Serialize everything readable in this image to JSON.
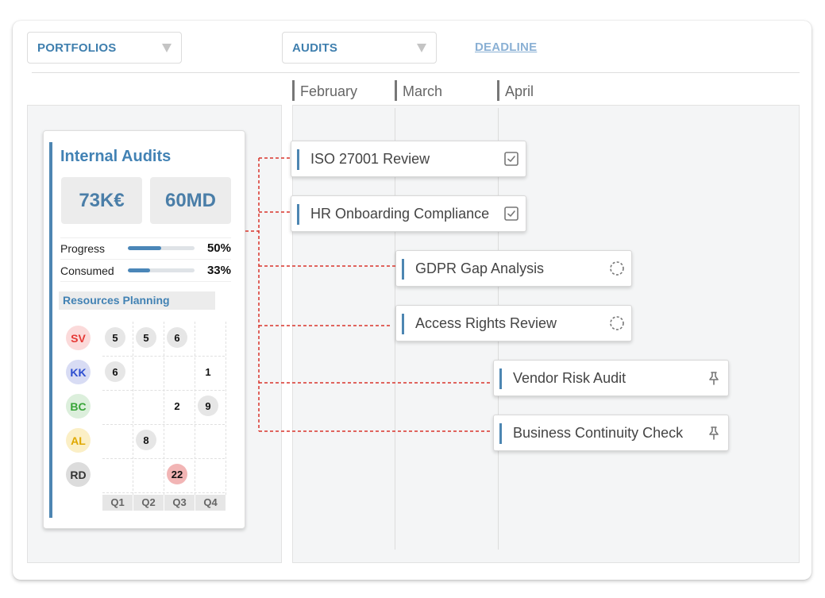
{
  "filters": {
    "portfolios": {
      "label": "PORTFOLIOS",
      "icon": "caret-down-icon"
    },
    "audits": {
      "label": "AUDITS",
      "icon": "caret-down-icon"
    },
    "deadline": {
      "label": "DEADLINE"
    }
  },
  "timeline": {
    "months": [
      "February",
      "March",
      "April"
    ]
  },
  "portfolio_card": {
    "title": "Internal Audits",
    "kpis": {
      "budget": "73K€",
      "effort": "60MD"
    },
    "progress": {
      "label": "Progress",
      "value": "50%",
      "fraction": 0.5
    },
    "consumed": {
      "label": "Consumed",
      "value": "33%",
      "fraction": 0.33
    },
    "resources_title": "Resources Planning",
    "resources": [
      {
        "initials": "SV",
        "color": "#e53935",
        "bg": "#fbdada",
        "q1": "5",
        "q2": "5",
        "q3": "6",
        "q4": ""
      },
      {
        "initials": "KK",
        "color": "#2e4fd0",
        "bg": "#d8dcf4",
        "q1": "6",
        "q2": "",
        "q3": "",
        "q4": "1"
      },
      {
        "initials": "BC",
        "color": "#38a538",
        "bg": "#dcefdc",
        "q1": "",
        "q2": "",
        "q3": "2",
        "q4": "9"
      },
      {
        "initials": "AL",
        "color": "#e0a800",
        "bg": "#fbefc6",
        "q1": "",
        "q2": "8",
        "q3": "",
        "q4": ""
      },
      {
        "initials": "RD",
        "color": "#333333",
        "bg": "#dcdcdc",
        "q1": "",
        "q2": "",
        "q3": "22",
        "q4": ""
      }
    ],
    "quarters": [
      "Q1",
      "Q2",
      "Q3",
      "Q4"
    ]
  },
  "tasks": [
    {
      "label": "ISO 27001 Review",
      "icon": "checkbox-checked-icon",
      "status": "done"
    },
    {
      "label": "HR Onboarding Compliance",
      "icon": "checkbox-checked-icon",
      "status": "done"
    },
    {
      "label": "GDPR Gap Analysis",
      "icon": "spinner-icon",
      "status": "in-progress"
    },
    {
      "label": "Access Rights Review",
      "icon": "spinner-icon",
      "status": "in-progress"
    },
    {
      "label": "Vendor Risk Audit",
      "icon": "pin-icon",
      "status": "planned"
    },
    {
      "label": "Business Continuity Check",
      "icon": "pin-icon",
      "status": "planned"
    }
  ],
  "colors": {
    "accent": "#4282b4",
    "connector": "#d9342b",
    "highlight_cell": "#f2b5b5"
  }
}
